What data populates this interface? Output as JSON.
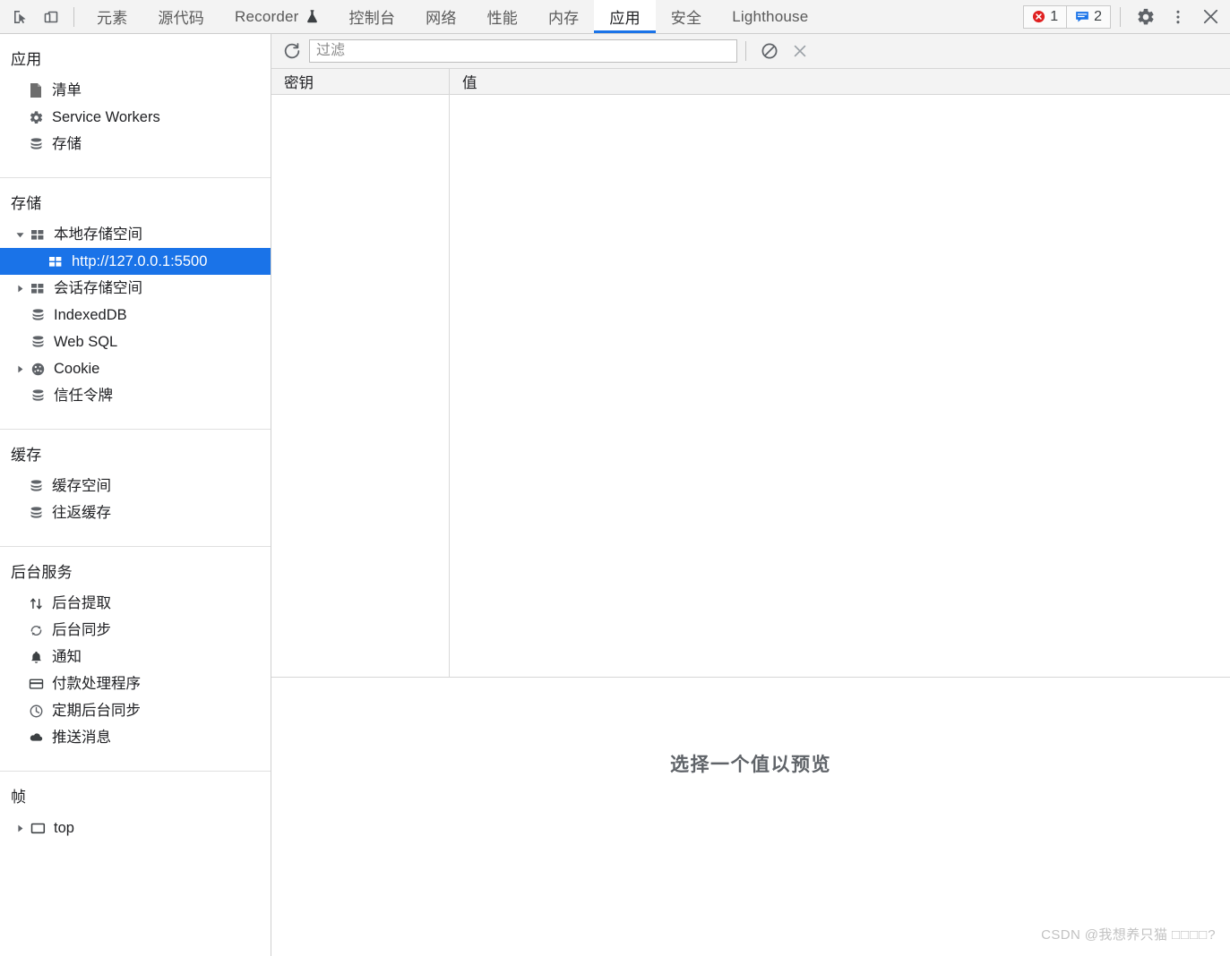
{
  "toolbar": {
    "inspect_icon": "inspect-cursor-icon",
    "device_icon": "device-toolbar-icon",
    "tabs": [
      {
        "label": "元素",
        "name": "tab-elements",
        "active": false
      },
      {
        "label": "源代码",
        "name": "tab-sources",
        "active": false
      },
      {
        "label": "Recorder",
        "name": "tab-recorder",
        "active": false,
        "flask": true
      },
      {
        "label": "控制台",
        "name": "tab-console",
        "active": false
      },
      {
        "label": "网络",
        "name": "tab-network",
        "active": false
      },
      {
        "label": "性能",
        "name": "tab-performance",
        "active": false
      },
      {
        "label": "内存",
        "name": "tab-memory",
        "active": false
      },
      {
        "label": "应用",
        "name": "tab-application",
        "active": true
      },
      {
        "label": "安全",
        "name": "tab-security",
        "active": false
      },
      {
        "label": "Lighthouse",
        "name": "tab-lighthouse",
        "active": false
      }
    ],
    "error_count": "1",
    "warning_count": "2",
    "error_color": "#e02020",
    "message_color": "#1a73e8",
    "settings_icon": "gear-icon",
    "more_icon": "kebab-menu-icon",
    "close_icon": "close-icon"
  },
  "sidebar": {
    "sections": [
      {
        "title": "应用",
        "name": "section-application",
        "items": [
          {
            "label": "清单",
            "icon": "manifest-document-icon",
            "name": "sidebar-item-manifest"
          },
          {
            "label": "Service Workers",
            "icon": "gear-icon",
            "name": "sidebar-item-service-workers"
          },
          {
            "label": "存储",
            "icon": "database-icon",
            "name": "sidebar-item-storage"
          }
        ]
      },
      {
        "title": "存储",
        "name": "section-storage",
        "items": [
          {
            "label": "本地存储空间",
            "icon": "table-grid-icon",
            "name": "sidebar-item-local-storage",
            "twisty": "expanded",
            "depth": 0
          },
          {
            "label": "http://127.0.0.1:5500",
            "icon": "table-grid-icon",
            "name": "sidebar-item-local-storage-origin",
            "twisty": "none",
            "depth": 1,
            "selected": true
          },
          {
            "label": "会话存储空间",
            "icon": "table-grid-icon",
            "name": "sidebar-item-session-storage",
            "twisty": "collapsed",
            "depth": 0
          },
          {
            "label": "IndexedDB",
            "icon": "database-icon",
            "name": "sidebar-item-indexeddb",
            "twisty": "none",
            "depth": 0
          },
          {
            "label": "Web SQL",
            "icon": "database-icon",
            "name": "sidebar-item-web-sql",
            "twisty": "none",
            "depth": 0
          },
          {
            "label": "Cookie",
            "icon": "cookie-icon",
            "name": "sidebar-item-cookie",
            "twisty": "collapsed",
            "depth": 0
          },
          {
            "label": "信任令牌",
            "icon": "database-icon",
            "name": "sidebar-item-trust-tokens",
            "twisty": "none",
            "depth": 0
          }
        ]
      },
      {
        "title": "缓存",
        "name": "section-cache",
        "items": [
          {
            "label": "缓存空间",
            "icon": "database-icon",
            "name": "sidebar-item-cache-storage"
          },
          {
            "label": "往返缓存",
            "icon": "database-icon",
            "name": "sidebar-item-back-forward-cache"
          }
        ]
      },
      {
        "title": "后台服务",
        "name": "section-background-services",
        "items": [
          {
            "label": "后台提取",
            "icon": "background-fetch-icon",
            "name": "sidebar-item-background-fetch"
          },
          {
            "label": "后台同步",
            "icon": "background-sync-icon",
            "name": "sidebar-item-background-sync"
          },
          {
            "label": "通知",
            "icon": "bell-icon",
            "name": "sidebar-item-notifications"
          },
          {
            "label": "付款处理程序",
            "icon": "payment-card-icon",
            "name": "sidebar-item-payment-handler"
          },
          {
            "label": "定期后台同步",
            "icon": "clock-icon",
            "name": "sidebar-item-periodic-background-sync"
          },
          {
            "label": "推送消息",
            "icon": "cloud-icon",
            "name": "sidebar-item-push-messaging"
          }
        ]
      },
      {
        "title": "帧",
        "name": "section-frames",
        "items": [
          {
            "label": "top",
            "icon": "frame-icon",
            "name": "sidebar-item-frame-top",
            "twisty": "collapsed",
            "depth": 0
          }
        ]
      }
    ]
  },
  "storage_toolbar": {
    "refresh_icon": "refresh-icon",
    "filter_placeholder": "过滤",
    "filter_value": "",
    "clear_all_icon": "clear-all-circle-slash-icon",
    "delete_icon": "delete-x-icon"
  },
  "table": {
    "columns": [
      {
        "label": "密钥",
        "name": "column-header-key"
      },
      {
        "label": "值",
        "name": "column-header-value"
      }
    ],
    "rows": []
  },
  "preview": {
    "empty_message": "选择一个值以预览"
  },
  "watermark": {
    "prefix": "CSDN @我想养只猫 ",
    "boxes": "□□□□",
    "suffix": "?"
  }
}
